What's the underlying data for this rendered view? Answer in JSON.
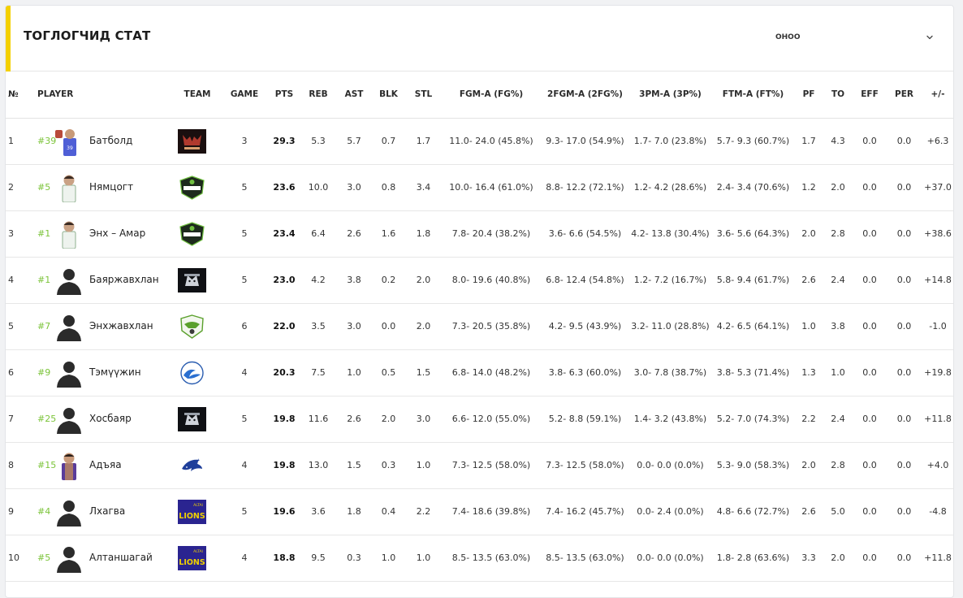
{
  "title": "ТОГЛОГЧИД СТАТ",
  "season_selector": {
    "label": "ОНОО",
    "icon": "chevron-down-icon"
  },
  "columns": [
    "№",
    "PLAYER",
    "TEAM",
    "GAME",
    "PTS",
    "REB",
    "AST",
    "BLK",
    "STL",
    "FGM-A (FG%)",
    "2FGM-A (2FG%)",
    "3PM-A (3P%)",
    "FTM-A (FT%)",
    "PF",
    "TO",
    "EFF",
    "PER",
    "+/-"
  ],
  "rows": [
    {
      "rank": "1",
      "number": "#39",
      "name": "Батболд",
      "avatar": "photo-red-blue",
      "team_logo": "team-dark-red",
      "game": "3",
      "pts": "29.3",
      "reb": "5.3",
      "ast": "5.7",
      "blk": "0.7",
      "stl": "1.7",
      "fg": "11.0- 24.0 (45.8%)",
      "fg2": "9.3- 17.0 (54.9%)",
      "fg3": "1.7- 7.0 (23.8%)",
      "ft": "5.7- 9.3 (60.7%)",
      "pf": "1.7",
      "to": "4.3",
      "eff": "0.0",
      "per": "0.0",
      "pm": "+6.3"
    },
    {
      "rank": "2",
      "number": "#5",
      "name": "Нямцогт",
      "avatar": "photo-green",
      "team_logo": "team-green-shield",
      "game": "5",
      "pts": "23.6",
      "reb": "10.0",
      "ast": "3.0",
      "blk": "0.8",
      "stl": "3.4",
      "fg": "10.0- 16.4 (61.0%)",
      "fg2": "8.8- 12.2 (72.1%)",
      "fg3": "1.2- 4.2 (28.6%)",
      "ft": "2.4- 3.4 (70.6%)",
      "pf": "1.2",
      "to": "2.0",
      "eff": "0.0",
      "per": "0.0",
      "pm": "+37.0"
    },
    {
      "rank": "3",
      "number": "#1",
      "name": "Энх – Амар",
      "avatar": "photo-green",
      "team_logo": "team-green-shield",
      "game": "5",
      "pts": "23.4",
      "reb": "6.4",
      "ast": "2.6",
      "blk": "1.6",
      "stl": "1.8",
      "fg": "7.8- 20.4 (38.2%)",
      "fg2": "3.6- 6.6 (54.5%)",
      "fg3": "4.2- 13.8 (30.4%)",
      "ft": "3.6- 5.6 (64.3%)",
      "pf": "2.0",
      "to": "2.8",
      "eff": "0.0",
      "per": "0.0",
      "pm": "+38.6"
    },
    {
      "rank": "4",
      "number": "#1",
      "name": "Баяржавхлан",
      "avatar": "silhouette",
      "team_logo": "team-dark-wolf",
      "game": "5",
      "pts": "23.0",
      "reb": "4.2",
      "ast": "3.8",
      "blk": "0.2",
      "stl": "2.0",
      "fg": "8.0- 19.6 (40.8%)",
      "fg2": "6.8- 12.4 (54.8%)",
      "fg3": "1.2- 7.2 (16.7%)",
      "ft": "5.8- 9.4 (61.7%)",
      "pf": "2.6",
      "to": "2.4",
      "eff": "0.0",
      "per": "0.0",
      "pm": "+14.8"
    },
    {
      "rank": "5",
      "number": "#7",
      "name": "Энхжавхлан",
      "avatar": "silhouette",
      "team_logo": "team-eagle-green",
      "game": "6",
      "pts": "22.0",
      "reb": "3.5",
      "ast": "3.0",
      "blk": "0.0",
      "stl": "2.0",
      "fg": "7.3- 20.5 (35.8%)",
      "fg2": "4.2- 9.5 (43.9%)",
      "fg3": "3.2- 11.0 (28.8%)",
      "ft": "4.2- 6.5 (64.1%)",
      "pf": "1.0",
      "to": "3.8",
      "eff": "0.0",
      "per": "0.0",
      "pm": "-1.0"
    },
    {
      "rank": "6",
      "number": "#9",
      "name": "Тэмүүжин",
      "avatar": "silhouette",
      "team_logo": "team-blue-wave",
      "game": "4",
      "pts": "20.3",
      "reb": "7.5",
      "ast": "1.0",
      "blk": "0.5",
      "stl": "1.5",
      "fg": "6.8- 14.0 (48.2%)",
      "fg2": "3.8- 6.3 (60.0%)",
      "fg3": "3.0- 7.8 (38.7%)",
      "ft": "3.8- 5.3 (71.4%)",
      "pf": "1.3",
      "to": "1.0",
      "eff": "0.0",
      "per": "0.0",
      "pm": "+19.8"
    },
    {
      "rank": "7",
      "number": "#25",
      "name": "Хосбаяр",
      "avatar": "silhouette",
      "team_logo": "team-dark-wolf",
      "game": "5",
      "pts": "19.8",
      "reb": "11.6",
      "ast": "2.6",
      "blk": "2.0",
      "stl": "3.0",
      "fg": "6.6- 12.0 (55.0%)",
      "fg2": "5.2- 8.8 (59.1%)",
      "fg3": "1.4- 3.2 (43.8%)",
      "ft": "5.2- 7.0 (74.3%)",
      "pf": "2.2",
      "to": "2.4",
      "eff": "0.0",
      "per": "0.0",
      "pm": "+11.8"
    },
    {
      "rank": "8",
      "number": "#15",
      "name": "Адъяа",
      "avatar": "photo-purple",
      "team_logo": "team-blue-shark",
      "game": "4",
      "pts": "19.8",
      "reb": "13.0",
      "ast": "1.5",
      "blk": "0.3",
      "stl": "1.0",
      "fg": "7.3- 12.5 (58.0%)",
      "fg2": "7.3- 12.5 (58.0%)",
      "fg3": "0.0- 0.0 (0.0%)",
      "ft": "5.3- 9.0 (58.3%)",
      "pf": "2.0",
      "to": "2.8",
      "eff": "0.0",
      "per": "0.0",
      "pm": "+4.0"
    },
    {
      "rank": "9",
      "number": "#4",
      "name": "Лхагва",
      "avatar": "silhouette",
      "team_logo": "team-altai-lions",
      "game": "5",
      "pts": "19.6",
      "reb": "3.6",
      "ast": "1.8",
      "blk": "0.4",
      "stl": "2.2",
      "fg": "7.4- 18.6 (39.8%)",
      "fg2": "7.4- 16.2 (45.7%)",
      "fg3": "0.0- 2.4 (0.0%)",
      "ft": "4.8- 6.6 (72.7%)",
      "pf": "2.6",
      "to": "5.0",
      "eff": "0.0",
      "per": "0.0",
      "pm": "-4.8"
    },
    {
      "rank": "10",
      "number": "#5",
      "name": "Алтаншагай",
      "avatar": "silhouette",
      "team_logo": "team-altai-lions",
      "game": "4",
      "pts": "18.8",
      "reb": "9.5",
      "ast": "0.3",
      "blk": "1.0",
      "stl": "1.0",
      "fg": "8.5- 13.5 (63.0%)",
      "fg2": "8.5- 13.5 (63.0%)",
      "fg3": "0.0- 0.0 (0.0%)",
      "ft": "1.8- 2.8 (63.6%)",
      "pf": "3.3",
      "to": "2.0",
      "eff": "0.0",
      "per": "0.0",
      "pm": "+11.8"
    }
  ],
  "colors": {
    "accent": "#f4d000",
    "jersey_number": "#7cc43a"
  },
  "logo_lettering": {
    "altai": "ALTAI",
    "lions": "LIONS"
  }
}
